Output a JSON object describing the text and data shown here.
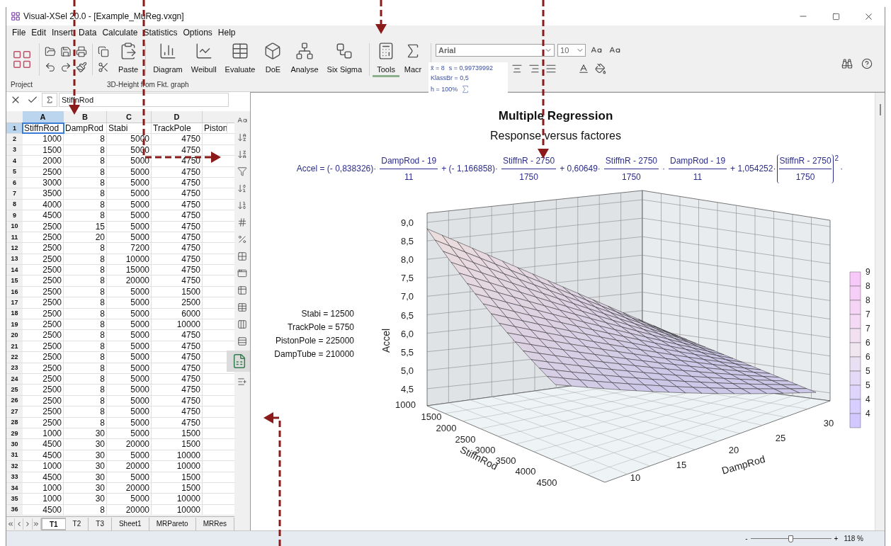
{
  "window": {
    "title": "Visual-XSel 20.0 - [Example_MuReg.vxgn]"
  },
  "menu": [
    "File",
    "Edit",
    "Insert",
    "Data",
    "Calculate",
    "Statistics",
    "Options",
    "Help"
  ],
  "ribbon": {
    "large_buttons": [
      {
        "label": "Paste",
        "selected": false
      },
      {
        "label": "Diagram",
        "selected": false
      },
      {
        "label": "Weibull",
        "selected": false
      },
      {
        "label": "Evaluate",
        "selected": false
      },
      {
        "label": "DoE",
        "selected": false
      },
      {
        "label": "Analyse",
        "selected": false
      },
      {
        "label": "Six Sigma",
        "selected": false
      },
      {
        "label": "Tools",
        "selected": true
      },
      {
        "label": "Macr",
        "selected": false
      }
    ],
    "font": {
      "family": "Arial",
      "size": "10"
    },
    "section_labels": [
      "Project",
      "3D-Height from Fkt. graph"
    ]
  },
  "formula_preview": {
    "lines": [
      "x̄ = 8",
      "s = 0,99739992",
      "KlassBr = 0,5",
      "h = 100%"
    ]
  },
  "formula_bar": {
    "value": "StiffnRod"
  },
  "sheet": {
    "columns": [
      {
        "label": "A",
        "selected": true
      },
      {
        "label": "B",
        "selected": false
      },
      {
        "label": "C",
        "selected": false
      },
      {
        "label": "D",
        "selected": false
      }
    ],
    "rows": [
      {
        "label": "1",
        "selected": true,
        "cells": [
          "StiffnRod",
          "DampRod",
          "Stabi",
          "TrackPole",
          "Piston"
        ]
      },
      {
        "label": "2",
        "selected": false,
        "cells": [
          "1000",
          "8",
          "5000",
          "4750"
        ]
      },
      {
        "label": "3",
        "selected": false,
        "cells": [
          "1500",
          "8",
          "5000",
          "4750"
        ]
      },
      {
        "label": "4",
        "selected": false,
        "cells": [
          "2000",
          "8",
          "5000",
          "4750"
        ]
      },
      {
        "label": "5",
        "selected": false,
        "cells": [
          "2500",
          "8",
          "5000",
          "4750"
        ]
      },
      {
        "label": "6",
        "selected": false,
        "cells": [
          "3000",
          "8",
          "5000",
          "4750"
        ]
      },
      {
        "label": "7",
        "selected": false,
        "cells": [
          "3500",
          "8",
          "5000",
          "4750"
        ]
      },
      {
        "label": "8",
        "selected": false,
        "cells": [
          "4000",
          "8",
          "5000",
          "4750"
        ]
      },
      {
        "label": "9",
        "selected": false,
        "cells": [
          "4500",
          "8",
          "5000",
          "4750"
        ]
      },
      {
        "label": "10",
        "selected": false,
        "cells": [
          "2500",
          "15",
          "5000",
          "4750"
        ]
      },
      {
        "label": "11",
        "selected": false,
        "cells": [
          "2500",
          "20",
          "5000",
          "4750"
        ]
      },
      {
        "label": "12",
        "selected": false,
        "cells": [
          "2500",
          "8",
          "7200",
          "4750"
        ]
      },
      {
        "label": "13",
        "selected": false,
        "cells": [
          "2500",
          "8",
          "10000",
          "4750"
        ]
      },
      {
        "label": "14",
        "selected": false,
        "cells": [
          "2500",
          "8",
          "15000",
          "4750"
        ]
      },
      {
        "label": "15",
        "selected": false,
        "cells": [
          "2500",
          "8",
          "20000",
          "4750"
        ]
      },
      {
        "label": "16",
        "selected": false,
        "cells": [
          "2500",
          "8",
          "5000",
          "1500"
        ]
      },
      {
        "label": "17",
        "selected": false,
        "cells": [
          "2500",
          "8",
          "5000",
          "2500"
        ]
      },
      {
        "label": "18",
        "selected": false,
        "cells": [
          "2500",
          "8",
          "5000",
          "6000"
        ]
      },
      {
        "label": "19",
        "selected": false,
        "cells": [
          "2500",
          "8",
          "5000",
          "10000"
        ]
      },
      {
        "label": "20",
        "selected": false,
        "cells": [
          "2500",
          "8",
          "5000",
          "4750"
        ]
      },
      {
        "label": "21",
        "selected": false,
        "cells": [
          "2500",
          "8",
          "5000",
          "4750"
        ]
      },
      {
        "label": "22",
        "selected": false,
        "cells": [
          "2500",
          "8",
          "5000",
          "4750"
        ]
      },
      {
        "label": "23",
        "selected": false,
        "cells": [
          "2500",
          "8",
          "5000",
          "4750"
        ]
      },
      {
        "label": "24",
        "selected": false,
        "cells": [
          "2500",
          "8",
          "5000",
          "4750"
        ]
      },
      {
        "label": "25",
        "selected": false,
        "cells": [
          "2500",
          "8",
          "5000",
          "4750"
        ]
      },
      {
        "label": "26",
        "selected": false,
        "cells": [
          "2500",
          "8",
          "5000",
          "4750"
        ]
      },
      {
        "label": "27",
        "selected": false,
        "cells": [
          "2500",
          "8",
          "5000",
          "4750"
        ]
      },
      {
        "label": "28",
        "selected": false,
        "cells": [
          "2500",
          "8",
          "5000",
          "4750"
        ]
      },
      {
        "label": "29",
        "selected": false,
        "cells": [
          "1000",
          "30",
          "5000",
          "1500"
        ]
      },
      {
        "label": "30",
        "selected": false,
        "cells": [
          "4500",
          "30",
          "20000",
          "1500"
        ]
      },
      {
        "label": "31",
        "selected": false,
        "cells": [
          "4500",
          "30",
          "5000",
          "10000"
        ]
      },
      {
        "label": "32",
        "selected": false,
        "cells": [
          "1000",
          "30",
          "20000",
          "10000"
        ]
      },
      {
        "label": "33",
        "selected": false,
        "cells": [
          "4500",
          "30",
          "5000",
          "1500"
        ]
      },
      {
        "label": "34",
        "selected": false,
        "cells": [
          "1000",
          "30",
          "20000",
          "1500"
        ]
      },
      {
        "label": "35",
        "selected": false,
        "cells": [
          "1000",
          "30",
          "5000",
          "10000"
        ]
      },
      {
        "label": "36",
        "selected": false,
        "cells": [
          "4500",
          "8",
          "20000",
          "10000"
        ]
      }
    ]
  },
  "side_tools": [
    {
      "selected": false
    },
    {
      "selected": false
    },
    {
      "selected": false
    },
    {
      "selected": false
    },
    {
      "selected": false
    },
    {
      "selected": false
    },
    {
      "selected": false
    },
    {
      "selected": false
    },
    {
      "selected": false
    },
    {
      "selected": false
    },
    {
      "selected": false
    },
    {
      "selected": false
    },
    {
      "selected": false
    },
    {
      "selected": false
    },
    {
      "selected": true
    },
    {
      "selected": false
    }
  ],
  "sheet_tabs": [
    {
      "label": "T1",
      "selected": true
    },
    {
      "label": "T2",
      "selected": false
    },
    {
      "label": "T3",
      "selected": false
    },
    {
      "label": "Sheet1",
      "selected": false
    },
    {
      "label": "MRPareto",
      "selected": false
    },
    {
      "label": "MRRes",
      "selected": false
    }
  ],
  "chart": {
    "title": "Multiple Regression",
    "subtitle": "Response versus factores",
    "equation": [
      {
        "kind": "text",
        "text": "Accel = (- 0,838326)·"
      },
      {
        "kind": "fraction",
        "numerator": "DampRod - 19",
        "denominator": "11"
      },
      {
        "kind": "text",
        "text": "+ (- 1,166858)·"
      },
      {
        "kind": "fraction",
        "numerator": "StiffnR - 2750",
        "denominator": "1750"
      },
      {
        "kind": "text",
        "text": "+ 0,60649·"
      },
      {
        "kind": "fraction",
        "numerator": "StiffnR - 2750",
        "denominator": "1750"
      },
      {
        "kind": "text",
        "text": "·"
      },
      {
        "kind": "fraction",
        "numerator": "DampRod - 19",
        "denominator": "11"
      },
      {
        "kind": "text",
        "text": "+ 1,054252·"
      },
      {
        "kind": "bracket_fraction",
        "numerator": "StiffnR - 2750",
        "denominator": "1750",
        "exponent": "2"
      },
      {
        "kind": "text",
        "text": "·"
      }
    ],
    "constants": [
      "Stabi = 12500",
      "TrackPole = 5750",
      "PistonPole = 225000",
      "DampTube = 210000"
    ],
    "z_axis": {
      "label": "Accel",
      "ticks": [
        "9,0",
        "8,5",
        "8,0",
        "7,5",
        "7,0",
        "6,5",
        "6,0",
        "5,5",
        "5,0",
        "4,5"
      ]
    },
    "x_axis": {
      "label": "StiffnRod",
      "ticks": [
        "1000",
        "1500",
        "2000",
        "2500",
        "3000",
        "3500",
        "4000",
        "4500"
      ]
    },
    "y_axis": {
      "label": "DampRod",
      "ticks": [
        "10",
        "15",
        "20",
        "25",
        "30"
      ]
    },
    "legend": [
      "9",
      "8",
      "8",
      "7",
      "7",
      "6",
      "6",
      "5",
      "5",
      "4",
      "4"
    ]
  },
  "status_bar": {
    "zoom": {
      "minus": "-",
      "plus": "+",
      "level": 0.5,
      "reading": "118 %"
    }
  }
}
